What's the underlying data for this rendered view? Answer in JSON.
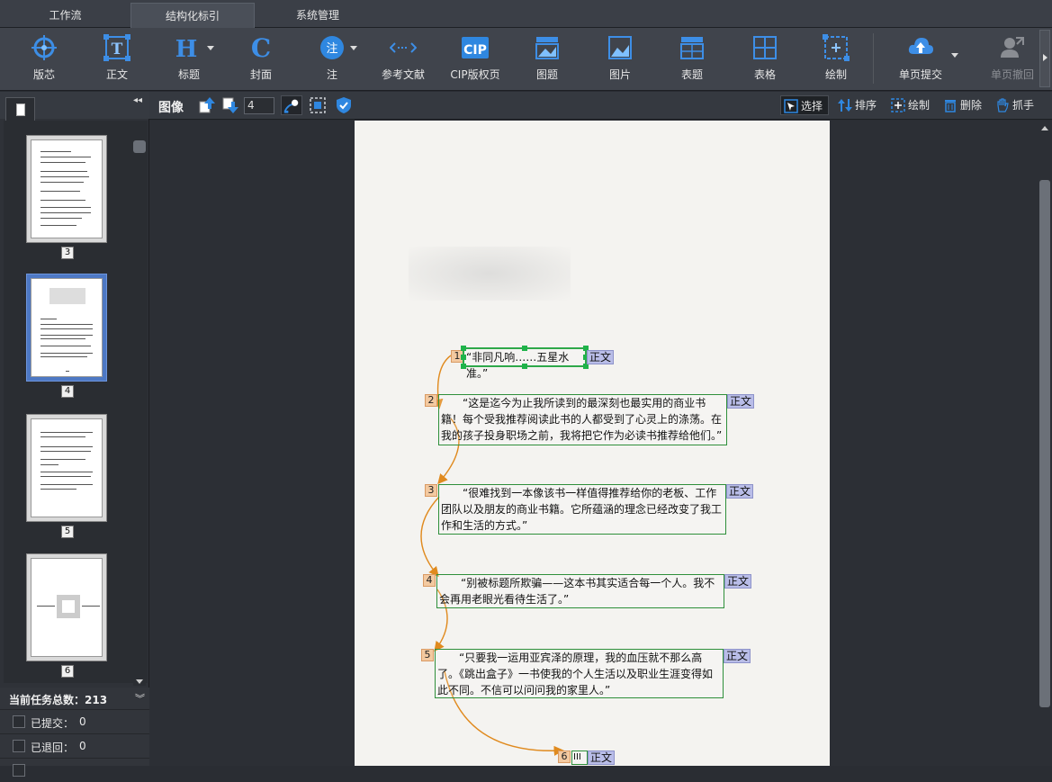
{
  "tabs": [
    {
      "label": "工作流",
      "active": false
    },
    {
      "label": "结构化标引",
      "active": true
    },
    {
      "label": "系统管理",
      "active": false
    }
  ],
  "toolbar": {
    "layout": "版芯",
    "body": "正文",
    "heading": "标题",
    "cover": "封面",
    "note": "注",
    "note_icon": "注",
    "references": "参考文献",
    "cip": "CIP版权页",
    "cip_icon": "CIP",
    "figure_title": "图题",
    "image": "图片",
    "table_title": "表题",
    "table": "表格",
    "draw": "绘制",
    "submit_page": "单页提交",
    "withdraw_page": "单页撤回"
  },
  "left_panel": {
    "thumbnails": [
      {
        "number": "3",
        "selected": false
      },
      {
        "number": "4",
        "selected": true
      },
      {
        "number": "5",
        "selected": false
      },
      {
        "number": "6",
        "selected": false
      }
    ],
    "total_label": "当前任务总数：",
    "total_value": "213",
    "submitted_label": "已提交：",
    "submitted_value": "0",
    "returned_label": "已退回：",
    "returned_value": "0"
  },
  "image_bar": {
    "title": "图像",
    "page_value": "4",
    "select": "选择",
    "sort": "排序",
    "draw": "绘制",
    "delete": "删除",
    "pan": "抓手"
  },
  "regions": [
    {
      "num": "1",
      "tag": "正文",
      "text": "“非同凡响……五星水准。”"
    },
    {
      "num": "2",
      "tag": "正文",
      "text": "　　“这是迄今为止我所读到的最深刻也最实用的商业书籍！每个受我推荐阅读此书的人都受到了心灵上的涤荡。在我的孩子投身职场之前，我将把它作为必读书推荐给他们。”"
    },
    {
      "num": "3",
      "tag": "正文",
      "text": "　　“很难找到一本像该书一样值得推荐给你的老板、工作团队以及朋友的商业书籍。它所蕴涵的理念已经改变了我工作和生活的方式。”"
    },
    {
      "num": "4",
      "tag": "正文",
      "text": "　　“别被标题所欺骗——这本书其实适合每一个人。我不会再用老眼光看待生活了。”"
    },
    {
      "num": "5",
      "tag": "正文",
      "text": "　　“只要我一运用亚宾泽的原理，我的血压就不那么高了。《跳出盒子》一书使我的个人生活以及职业生涯变得如此不同。不信可以问问我的家里人。”"
    },
    {
      "num": "6",
      "tag": "正文",
      "text": "III"
    }
  ],
  "colors": {
    "region_border": "#2e8f3a",
    "flow_arrow": "#e08a1e",
    "num_bg": "#f3c9a0",
    "tag_bg": "#b9bde8",
    "selected_thumb": "#4d78c4"
  }
}
